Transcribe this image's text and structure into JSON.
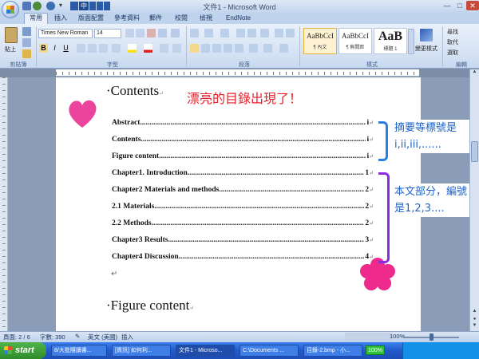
{
  "window": {
    "title": "文件1 - Microsoft Word",
    "ime_label": "中"
  },
  "ribbon_tabs": [
    {
      "label": "常用",
      "active": true
    },
    {
      "label": "插入",
      "active": false
    },
    {
      "label": "版面配置",
      "active": false
    },
    {
      "label": "參考資料",
      "active": false
    },
    {
      "label": "郵件",
      "active": false
    },
    {
      "label": "校閱",
      "active": false
    },
    {
      "label": "檢視",
      "active": false
    },
    {
      "label": "EndNote",
      "active": false
    }
  ],
  "ribbon": {
    "font_name": "Times New Roman",
    "font_size": "14",
    "paste_label": "貼上",
    "groups": [
      "剪貼簿",
      "字型",
      "段落",
      "樣式",
      "編輯"
    ],
    "styles": [
      {
        "sample": "AaBbCcI",
        "name": "¶ 內文",
        "selected": true
      },
      {
        "sample": "AaBbCcI",
        "name": "¶ 無間距",
        "selected": false
      },
      {
        "sample": "AaB",
        "name": "標題 1",
        "selected": false
      }
    ],
    "change_styles_label": "變更樣式",
    "edit_items": [
      "尋找",
      "取代",
      "選取"
    ]
  },
  "document": {
    "heading": "Contents",
    "annotation_title": "漂亮的目錄出現了！",
    "toc_entries": [
      {
        "title": "Abstract",
        "page": "i"
      },
      {
        "title": "Contents",
        "page": "i"
      },
      {
        "title": "Figure content",
        "page": "i"
      },
      {
        "title": "Chapter1. Introduction",
        "page": "1"
      },
      {
        "title": "Chapter2 Materials and methods",
        "page": "2"
      },
      {
        "title": "2.1 Materials",
        "page": "2"
      },
      {
        "title": "2.2 Methods",
        "page": "2"
      },
      {
        "title": "Chapter3 Results",
        "page": "3"
      },
      {
        "title": "Chapter4 Discussion",
        "page": "4"
      }
    ],
    "para_mark": "↵",
    "figure_heading": "Figure content",
    "note_roman": "摘要等標號是i,ii,iii,......",
    "note_arabic": "本文部分，編號是1,2,3....",
    "colors": {
      "annotation_red": "#e8202a",
      "bracket_blue": "#2b7fe0",
      "bracket_purple": "#8a2be2",
      "note_text": "#1f63c9"
    }
  },
  "status": {
    "page": "頁面: 2 / 6",
    "words": "字數: 390",
    "language": "英文 (美國)",
    "mode": "插入",
    "zoom": "100%"
  },
  "taskbar": {
    "start": "start",
    "tasks": [
      {
        "label": "8/大批隨讀書...",
        "active": false
      },
      {
        "label": "[資訊] 如何利...",
        "active": false
      },
      {
        "label": "文件1 - Microso...",
        "active": true
      },
      {
        "label": "C:\\Documents ...",
        "active": false
      },
      {
        "label": "目錄-2.bmp - 小...",
        "active": false
      }
    ],
    "battery": "100%"
  }
}
